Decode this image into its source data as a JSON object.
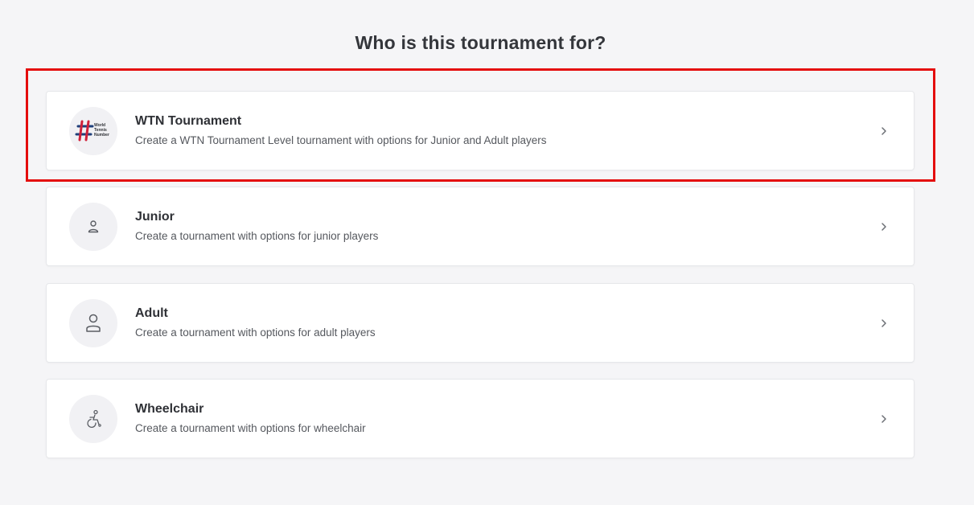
{
  "page": {
    "title": "Who is this tournament for?"
  },
  "options": [
    {
      "title": "WTN Tournament",
      "description": "Create a WTN Tournament Level tournament with options for Junior and Adult players",
      "icon": "wtn-logo-icon",
      "logo_text": [
        "World",
        "Tennis",
        "Number"
      ]
    },
    {
      "title": "Junior",
      "description": "Create a tournament with options for junior players",
      "icon": "junior-person-icon"
    },
    {
      "title": "Adult",
      "description": "Create a tournament with options for adult players",
      "icon": "adult-person-icon"
    },
    {
      "title": "Wheelchair",
      "description": "Create a tournament with options for wheelchair",
      "icon": "wheelchair-icon"
    }
  ],
  "colors": {
    "highlight": "#e40d0d",
    "background": "#f5f5f7",
    "card": "#ffffff"
  }
}
